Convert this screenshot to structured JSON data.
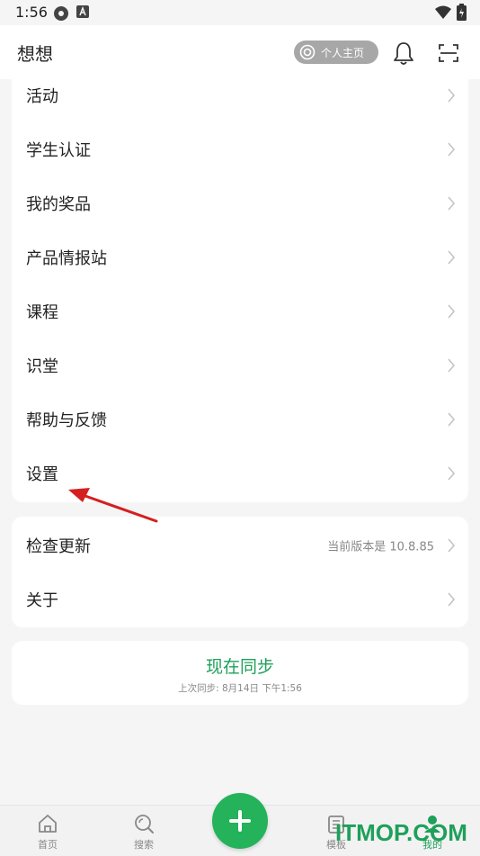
{
  "status_bar": {
    "time": "1:56"
  },
  "header": {
    "title": "想想",
    "home_button": "个人主页"
  },
  "menu": {
    "items": [
      {
        "label": "活动"
      },
      {
        "label": "学生认证"
      },
      {
        "label": "我的奖品"
      },
      {
        "label": "产品情报站"
      },
      {
        "label": "课程"
      },
      {
        "label": "识堂"
      },
      {
        "label": "帮助与反馈"
      },
      {
        "label": "设置"
      }
    ]
  },
  "about_section": {
    "check_update": "检查更新",
    "version_text": "当前版本是 10.8.85",
    "about": "关于"
  },
  "sync": {
    "button": "现在同步",
    "last_sync": "上次同步: 8月14日 下午1:56"
  },
  "tabbar": {
    "tabs": [
      {
        "label": "首页",
        "icon": "home-icon"
      },
      {
        "label": "搜索",
        "icon": "search-icon"
      },
      {
        "label": "模板",
        "icon": "template-icon"
      },
      {
        "label": "我的",
        "icon": "profile-icon",
        "active": true
      }
    ],
    "add_icon": "plus-icon"
  },
  "watermark": "ITMOP.COM",
  "colors": {
    "accent": "#24b35a",
    "annotation_arrow": "#d42020"
  }
}
